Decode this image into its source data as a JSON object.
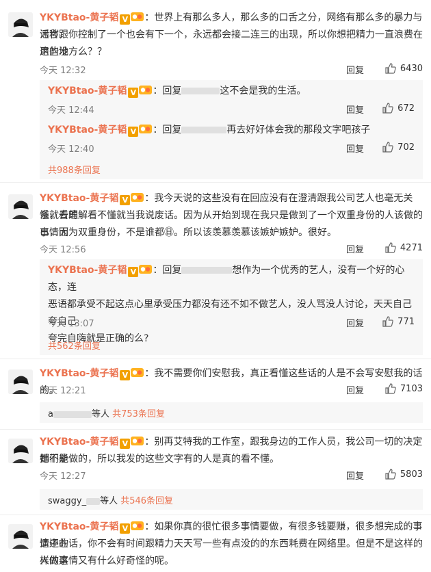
{
  "user": {
    "name": "YKYBtao-黄子韬",
    "v_badge": "V"
  },
  "common": {
    "reply_label": "回复"
  },
  "comments": [
    {
      "text": "：世界上有那么多人，那么多的口舌之分，网络有那么多的暴力与谣言跟",
      "text2": "污秽，你控制了一个也会有下一个，永远都会接二连三的出现，所以你想把精力一直浪费在这些没",
      "text3": "用的地方么？？",
      "time": "今天 12:32",
      "likes": "6430",
      "replies": [
        {
          "prefix": "：回复",
          "text": "这不会是我的生活。",
          "time": "今天 12:44",
          "likes": "672"
        },
        {
          "prefix": "：回复",
          "text": "再去好好体会我的那段文字吧孩子",
          "time": "今天 12:40",
          "likes": "702"
        }
      ],
      "more": "共988条回复"
    },
    {
      "text": "：我今天说的这些没有在回应没有在澄清跟我公司艺人也毫无关系，看的",
      "text2": "懂就去理解看不懂就当我说废话。因为从开始到现在我只是做到了一个双重身份的人该做的事情而",
      "text3": "已，因为双重身份，不是谁都㊐。所以该羡慕羡慕该嫉妒嫉妒。很好。",
      "time": "今天 12:56",
      "likes": "4271",
      "replies": [
        {
          "prefix": "：回复",
          "text": "想作为一个优秀的艺人，没有一个好的心态，连",
          "text2": "恶语都承受不起这点心里承受压力都没有还不如不做艺人，没人骂没人讨论，天天自己夸自己",
          "text3": "夸完自嗨就是正确的么?",
          "time": "今天 13:07",
          "likes": "771"
        }
      ],
      "more": "共562条回复"
    },
    {
      "text": "：我不需要你们安慰我，真正看懂这些话的人是不会写安慰我的话的。",
      "time": "今天 12:21",
      "likes": "7103",
      "summary_prefix": "等人",
      "summary_user": "a",
      "more": "共753条回复"
    },
    {
      "text": "：别再艾特我的工作室，跟我身边的工作人员，我公司一切的决定都不是",
      "text2": "她们能做的，所以我发的这些文字有的人是真的看不懂。",
      "time": "今天 12:27",
      "likes": "5803",
      "summary_prefix": "等人",
      "summary_user": "swaggy_",
      "more": "共546条回复"
    },
    {
      "text": "：如果你真的很忙很多事情要做，有很多钱要赚，很多想完成的事情还在",
      "text2": "途中的话，你不会有时间跟精力天天写一些有点没的的东西耗费在网络里。但是不是这样的人做这",
      "text3": "样的事情又有什么好奇怪的呢。"
    }
  ],
  "colors": {
    "username": "#eb7350",
    "v_badge": "#f2a000",
    "reply_bg": "#f7f7f7"
  }
}
